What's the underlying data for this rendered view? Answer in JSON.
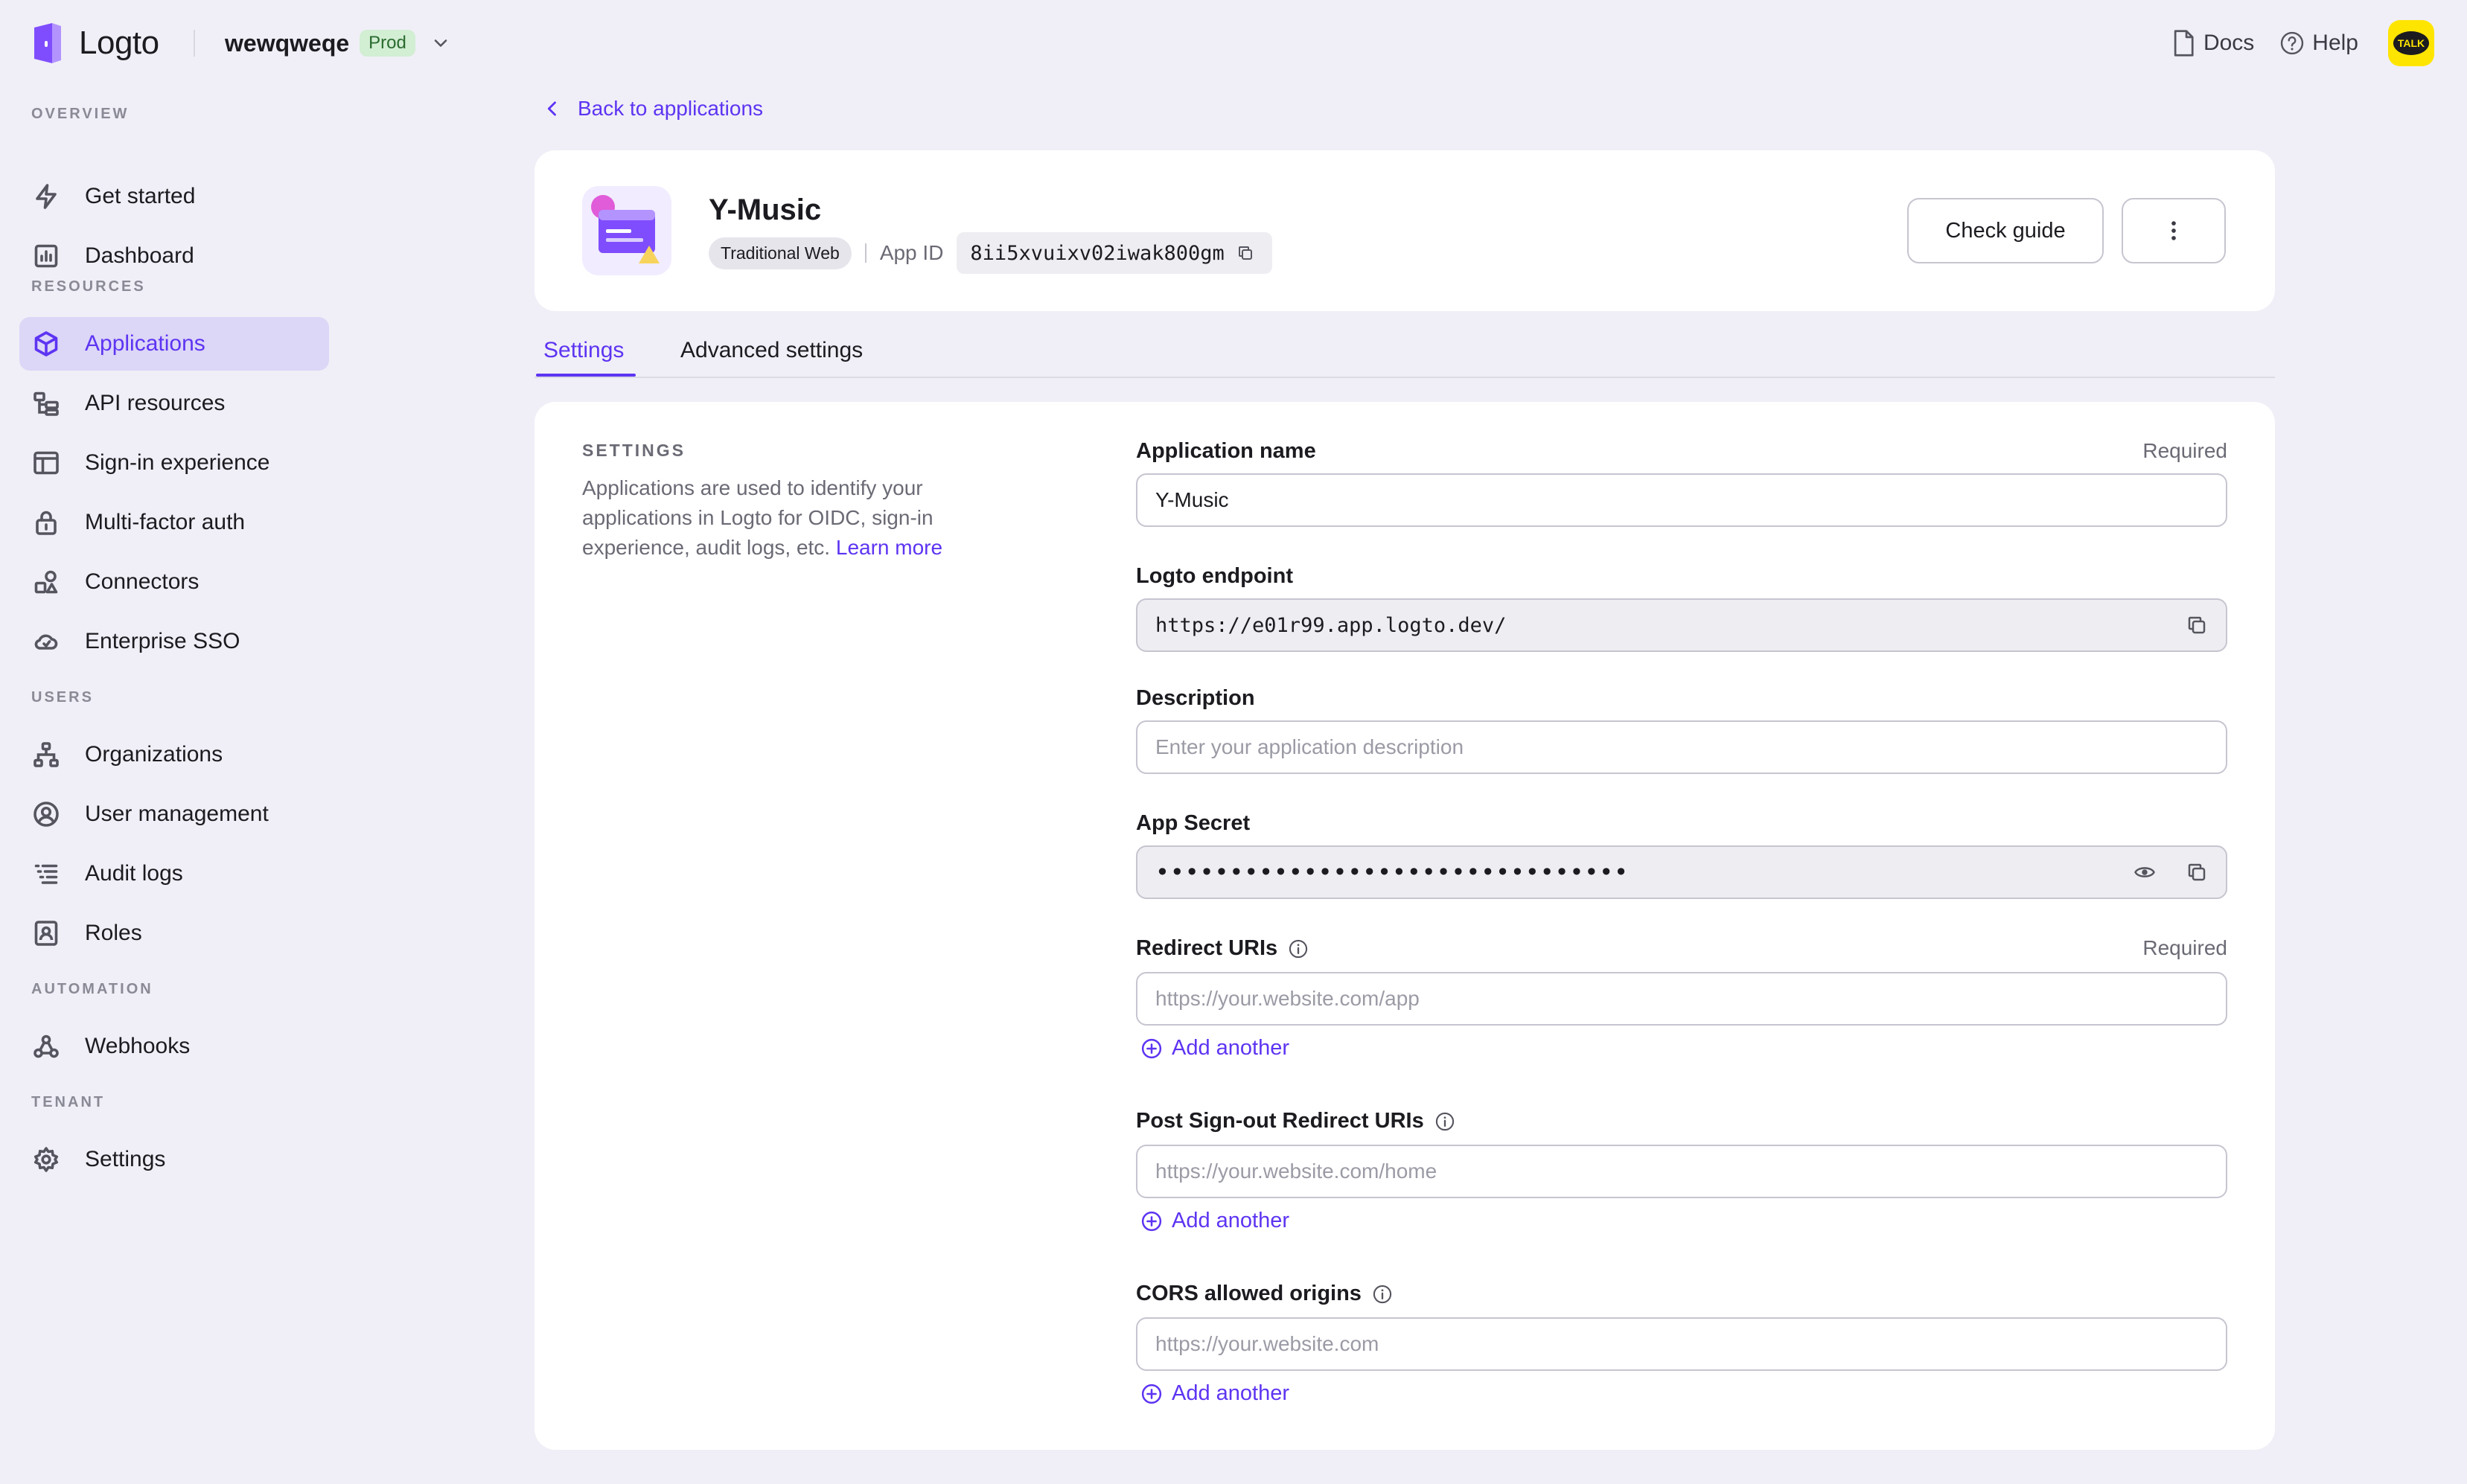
{
  "brand": {
    "name": "Logto",
    "accent": "#5d34f2"
  },
  "tenant": {
    "name": "wewqweqe",
    "env": "Prod"
  },
  "top_links": {
    "docs": "Docs",
    "help": "Help",
    "talk": "TALK"
  },
  "sidebar": {
    "sections": {
      "overview": "OVERVIEW",
      "resources": "RESOURCES",
      "users": "USERS",
      "automation": "AUTOMATION",
      "tenant": "TENANT"
    },
    "items": {
      "get_started": "Get started",
      "dashboard": "Dashboard",
      "applications": "Applications",
      "api_resources": "API resources",
      "sign_in_experience": "Sign-in experience",
      "mfa": "Multi-factor auth",
      "connectors": "Connectors",
      "enterprise_sso": "Enterprise SSO",
      "organizations": "Organizations",
      "user_management": "User management",
      "audit_logs": "Audit logs",
      "roles": "Roles",
      "webhooks": "Webhooks",
      "settings": "Settings"
    },
    "active": "Applications"
  },
  "back_link": "Back to applications",
  "app": {
    "name": "Y-Music",
    "type": "Traditional Web",
    "app_id_label": "App ID",
    "app_id": "8ii5xvuixv02iwak800gm",
    "check_guide": "Check guide"
  },
  "tabs": {
    "settings": "Settings",
    "advanced": "Advanced settings"
  },
  "settings_panel": {
    "title": "SETTINGS",
    "description": "Applications are used to identify your applications in Logto for OIDC, sign-in experience, audit logs, etc.",
    "learn_more": "Learn more"
  },
  "form": {
    "required": "Required",
    "app_name": {
      "label": "Application name",
      "value": "Y-Music"
    },
    "endpoint": {
      "label": "Logto endpoint",
      "value": "https://e01r99.app.logto.dev/"
    },
    "description": {
      "label": "Description",
      "placeholder": "Enter your application description"
    },
    "app_secret": {
      "label": "App Secret",
      "value": "••••••••••••••••••••••••••••••••"
    },
    "redirect_uris": {
      "label": "Redirect URIs",
      "placeholder": "https://your.website.com/app"
    },
    "post_signout": {
      "label": "Post Sign-out Redirect URIs",
      "placeholder": "https://your.website.com/home"
    },
    "cors": {
      "label": "CORS allowed origins",
      "placeholder": "https://your.website.com"
    },
    "add_another": "Add another"
  }
}
